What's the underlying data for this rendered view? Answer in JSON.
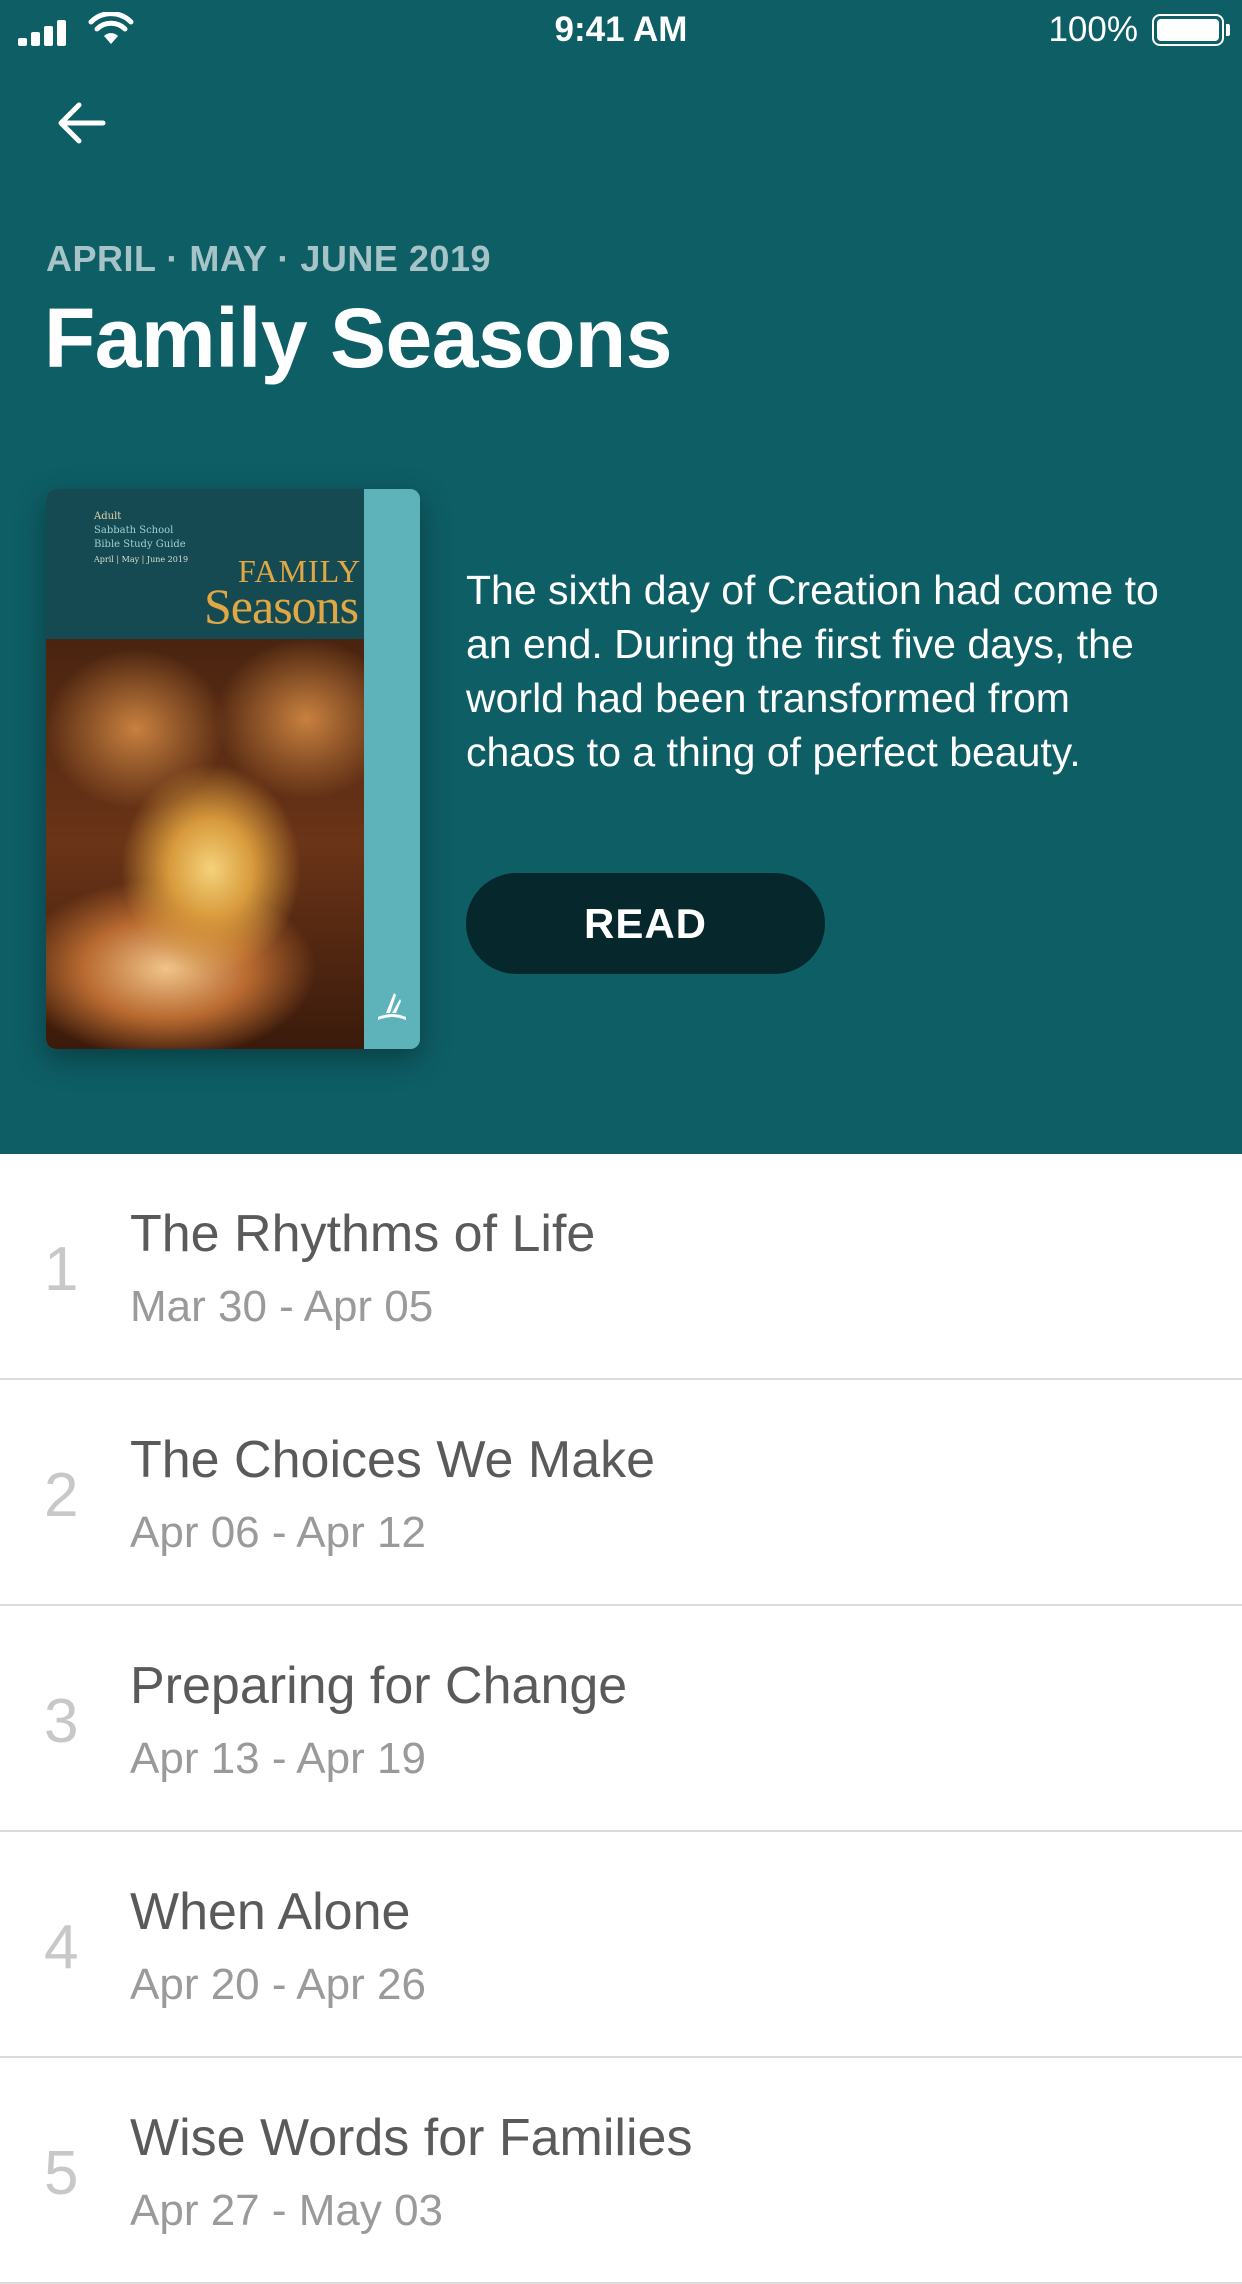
{
  "status_bar": {
    "time": "9:41 AM",
    "battery": "100%"
  },
  "header": {
    "back_icon": "arrow-left-icon",
    "quarter": "APRIL · MAY · JUNE 2019",
    "title": "Family Seasons",
    "description": "The sixth day of Creation had come to an end. During the first five days, the world had been transformed from chaos to a thing of perfect beauty.",
    "read_label": "READ",
    "colors": {
      "header_bg": "#0e5e66",
      "button_bg": "#06272b",
      "spine": "#5db3b9"
    }
  },
  "cover": {
    "line1": "Adult",
    "line2": "Sabbath School",
    "line3": "Bible Study Guide",
    "line4": "April | May | June 2019",
    "family": "FAMILY",
    "seasons": "Seasons"
  },
  "lessons": [
    {
      "number": "1",
      "title": "The Rhythms of Life",
      "dates": "Mar 30 - Apr 05"
    },
    {
      "number": "2",
      "title": "The Choices We Make",
      "dates": "Apr 06 - Apr 12"
    },
    {
      "number": "3",
      "title": "Preparing for Change",
      "dates": "Apr 13 - Apr 19"
    },
    {
      "number": "4",
      "title": "When Alone",
      "dates": "Apr 20 - Apr 26"
    },
    {
      "number": "5",
      "title": "Wise Words for Families",
      "dates": "Apr 27 - May 03"
    }
  ]
}
